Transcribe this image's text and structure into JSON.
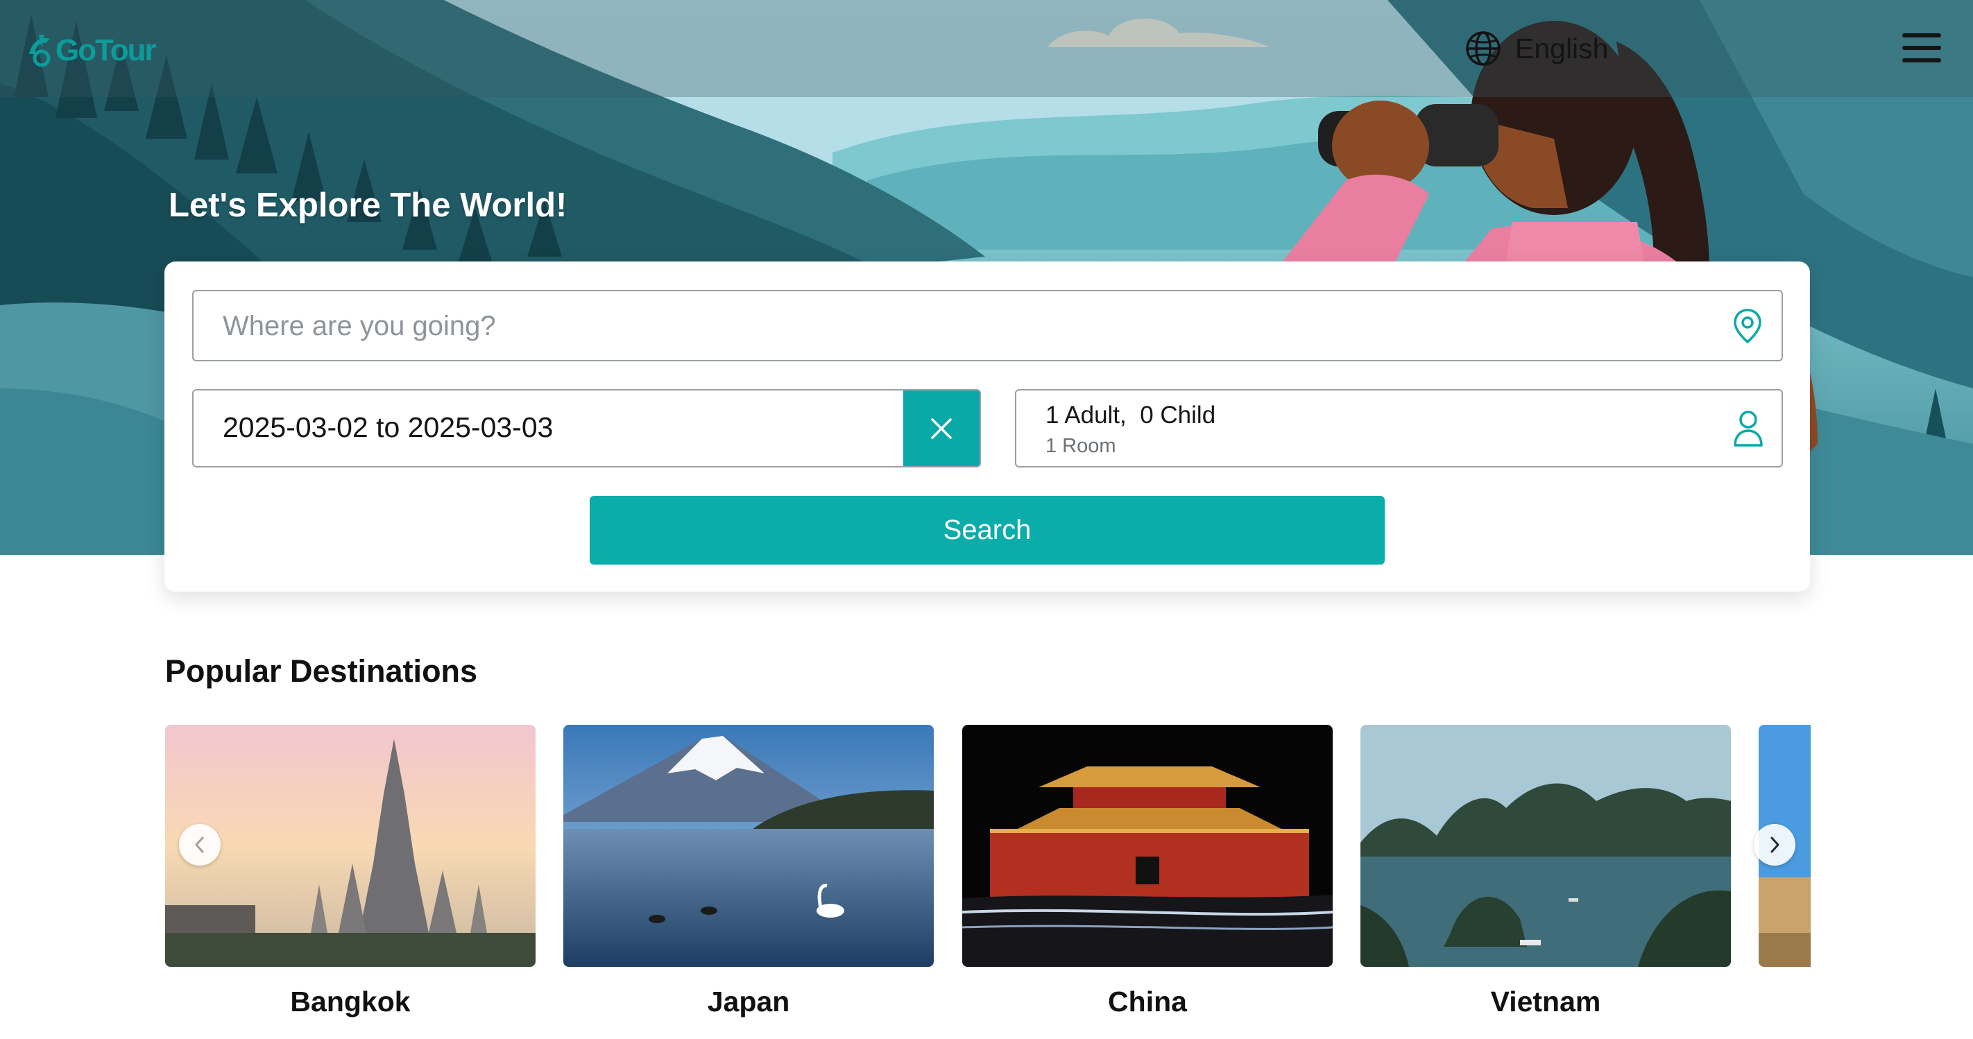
{
  "header": {
    "logo_text": "GoTour",
    "language_label": "English",
    "menu_icon": "hamburger-icon"
  },
  "hero": {
    "title": "Let's Explore The World!"
  },
  "search": {
    "destination_placeholder": "Where are you going?",
    "destination_icon": "location-pin-icon",
    "dates_value": "2025-03-02 to 2025-03-03",
    "clear_icon": "close-icon",
    "adults_text": "1 Adult,",
    "children_text": "0 Child",
    "rooms_text": "1 Room",
    "guests_icon": "user-icon",
    "search_label": "Search"
  },
  "popular": {
    "title": "Popular Destinations",
    "destinations": [
      {
        "name": "Bangkok"
      },
      {
        "name": "Japan"
      },
      {
        "name": "China"
      },
      {
        "name": "Vietnam"
      }
    ],
    "prev_icon": "chevron-left-icon",
    "next_icon": "chevron-right-icon"
  },
  "colors": {
    "accent": "#0aadaa",
    "logo": "#0c9c9a",
    "hero_dark": "#1c5a66",
    "hero_light": "#8fd0d8"
  }
}
